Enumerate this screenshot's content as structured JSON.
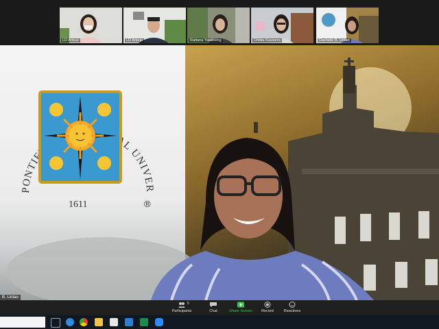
{
  "gallery": {
    "participants": [
      {
        "name": "LD Artsup"
      },
      {
        "name": "LD Artsup"
      },
      {
        "name": "Rattana Yawiloeng"
      },
      {
        "name": "Chittia Kaweera"
      },
      {
        "name": "Rachelle B. Lintao"
      }
    ]
  },
  "slide": {
    "seal_text": "PONTIFICAL AND ROYAL UNIVERSITY OF SANTO TOMAS, MANILA",
    "seal_year": "1611",
    "registered_mark": "®"
  },
  "speaker": {
    "name": "B. Lintao"
  },
  "toolbar": {
    "participants_count": "5",
    "participants_label": "Participants",
    "chat_label": "Chat",
    "share_label": "Share Screen",
    "record_label": "Record",
    "reactions_label": "Reactions"
  },
  "colors": {
    "share_accent": "#2ecc40",
    "toolbar_bg": "#1f1f1f",
    "taskbar_bg": "#101820"
  },
  "taskbar": {
    "icons": [
      "search-icon",
      "task-view-icon",
      "edge-icon",
      "chrome-icon",
      "file-explorer-icon",
      "store-icon",
      "mail-icon",
      "excel-icon",
      "zoom-icon"
    ]
  }
}
